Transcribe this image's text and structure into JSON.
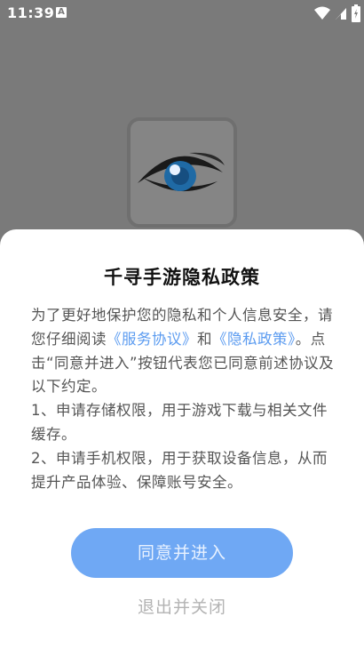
{
  "status_bar": {
    "time": "11:39",
    "notification_icon_letter": "A",
    "icons": [
      "wifi-icon",
      "signal-icon",
      "battery-icon"
    ]
  },
  "splash": {
    "logo_icon": "eye-icon"
  },
  "dialog": {
    "title": "千寻手游隐私政策",
    "intro_prefix": "为了更好地保护您的隐私和个人信息安全，请您仔细阅读",
    "service_link": "《服务协议》",
    "and_text": "和",
    "privacy_link": "《隐私政策》",
    "intro_suffix": "。点击“同意并进入”按钮代表您已同意前述协议及以下约定。",
    "item1": "1、申请存储权限，用于游戏下载与相关文件缓存。",
    "item2": "2、申请手机权限，用于获取设备信息，从而提升产品体验、保障账号安全。",
    "agree_label": "同意并进入",
    "exit_label": "退出并关闭"
  },
  "colors": {
    "overlay": "#7a7a7a",
    "link": "#5b9bf0",
    "primary_button": "#6fa8f4",
    "secondary_text": "#b3b3b3"
  }
}
